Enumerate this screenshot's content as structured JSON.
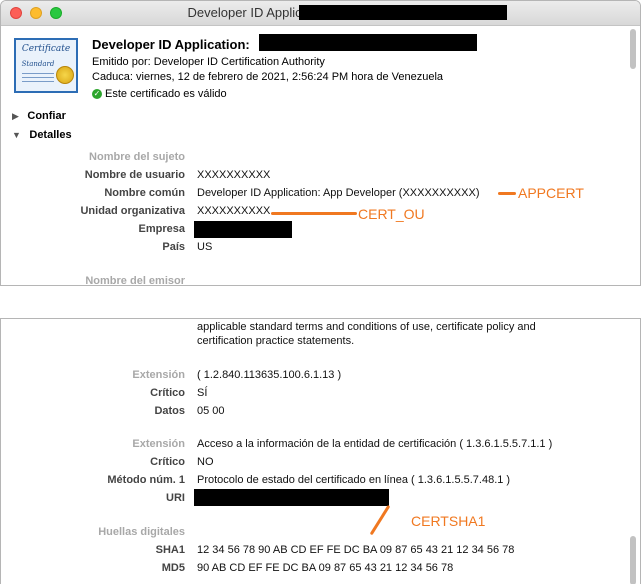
{
  "window": {
    "title": "Developer ID Application:"
  },
  "certificate": {
    "icon_top": "Certificate",
    "icon_bottom": "Standard",
    "name": "Developer ID Application:",
    "issued_by": "Emitido por: Developer ID Certification Authority",
    "expires": "Caduca: viernes, 12 de febrero de 2021, 2:56:24 PM hora de Venezuela",
    "valid_text": "Este certificado es válido",
    "valid_color": "#2da52d"
  },
  "sections": {
    "trust": "Confiar",
    "details": "Detalles"
  },
  "subject": {
    "header": "Nombre del sujeto",
    "rows": [
      {
        "label": "Nombre de usuario",
        "value": "XXXXXXXXXX"
      },
      {
        "label": "Nombre común",
        "value": "Developer ID Application: App Developer (XXXXXXXXXX)"
      },
      {
        "label": "Unidad organizativa",
        "value": "XXXXXXXXXX"
      },
      {
        "label": "Empresa",
        "value": ""
      },
      {
        "label": "País",
        "value": "US"
      }
    ],
    "issuer_header": "Nombre del emisor"
  },
  "annotations": {
    "appcert": "APPCERT",
    "cert_ou": "CERT_OU",
    "certsha1": "CERTSHA1",
    "color": "#f07820"
  },
  "lower": {
    "policy_text_1": "applicable standard terms and conditions of use, certificate policy and",
    "policy_text_2": "certification practice statements.",
    "ext1": {
      "extension_label": "Extensión",
      "extension_value": "( 1.2.840.113635.100.6.1.13 )",
      "critical_label": "Crítico",
      "critical_value": "SÍ",
      "data_label": "Datos",
      "data_value": "05 00"
    },
    "ext2": {
      "extension_label": "Extensión",
      "extension_value": "Acceso a la información de la entidad de certificación ( 1.3.6.1.5.5.7.1.1 )",
      "critical_label": "Crítico",
      "critical_value": "NO",
      "method_label": "Método núm. 1",
      "method_value": "Protocolo de estado del certificado en línea ( 1.3.6.1.5.5.7.48.1 )",
      "uri_label": "URI"
    },
    "fingerprints": {
      "header": "Huellas digitales",
      "sha1_label": "SHA1",
      "sha1_value": "12 34 56 78 90 AB CD EF FE DC BA 09 87 65 43 21 12 34 56 78",
      "md5_label": "MD5",
      "md5_value": "90 AB CD EF FE DC BA 09 87 65 43 21 12 34 56 78"
    }
  }
}
